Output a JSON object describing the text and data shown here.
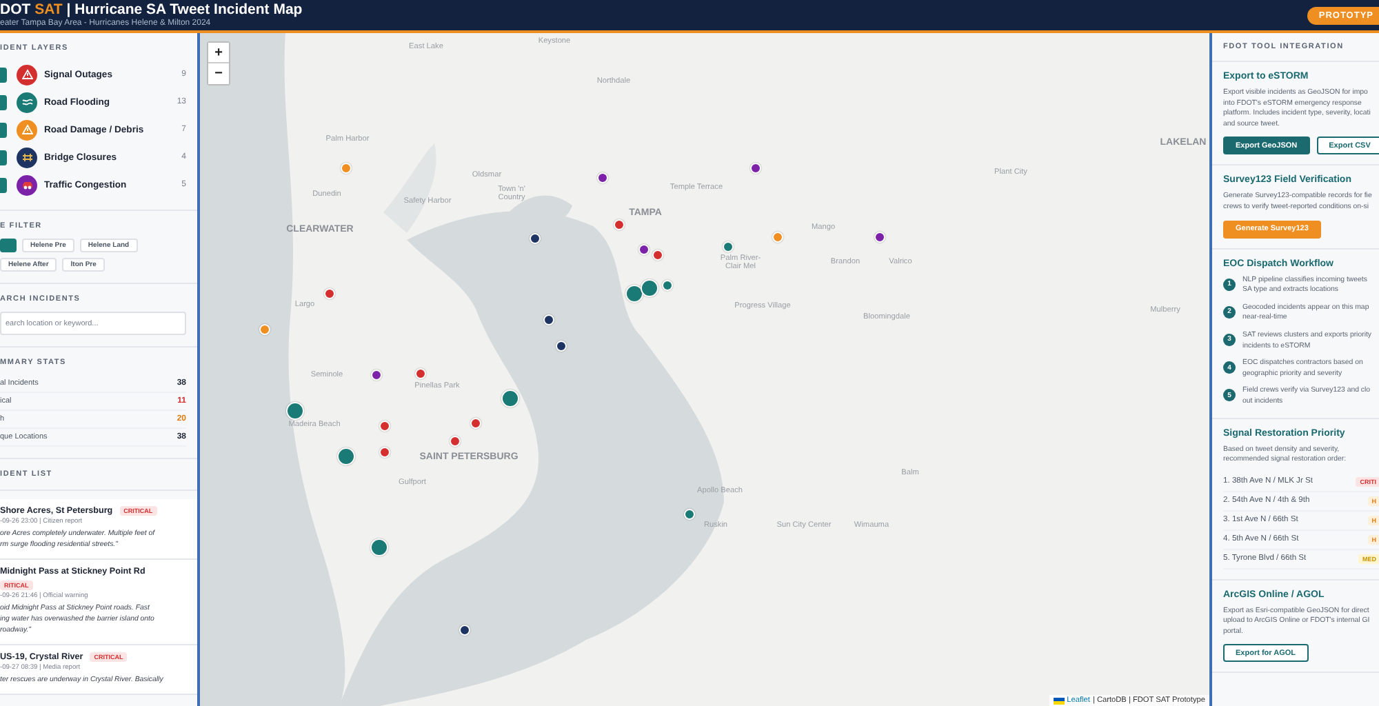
{
  "header": {
    "title_start": "DOT",
    "title_accent": "SAT",
    "title_rest": "| Hurricane SA Tweet Incident Map",
    "subtitle": "eater Tampa Bay Area - Hurricanes Helene & Milton 2024",
    "badge": "PROTOTYP"
  },
  "sidebar": {
    "layers_heading": "IDENT LAYERS",
    "layers": [
      {
        "label": "Signal Outages",
        "count": "9",
        "checked": true,
        "color": "#d32f2f",
        "kind": "signal"
      },
      {
        "label": "Road Flooding",
        "count": "13",
        "checked": true,
        "color": "#1a7a76",
        "kind": "flood"
      },
      {
        "label": "Road Damage / Debris",
        "count": "7",
        "checked": true,
        "color": "#ef8f22",
        "kind": "damage"
      },
      {
        "label": "Bridge Closures",
        "count": "4",
        "checked": true,
        "color": "#1e3563",
        "kind": "bridge"
      },
      {
        "label": "Traffic Congestion",
        "count": "5",
        "checked": true,
        "color": "#7b22a8",
        "kind": "traffic"
      }
    ],
    "filter_heading": "E FILTER",
    "filters": [
      {
        "selected": true
      },
      {
        "label": "Helene Pre",
        "selected": false
      },
      {
        "label": "Helene Land",
        "selected": false
      },
      {
        "label": "Helene After",
        "selected": false
      },
      {
        "label": "lton Pre",
        "selected": false
      }
    ],
    "search_heading": "ARCH INCIDENTS",
    "search": {
      "placeholder": "earch location or keyword..."
    },
    "stats_heading": "MMARY STATS",
    "stats": [
      {
        "label": "al Incidents",
        "value": "38",
        "kind": "plain"
      },
      {
        "label": "ical",
        "value": "11",
        "kind": "critical"
      },
      {
        "label": "h",
        "value": "20",
        "kind": "high"
      },
      {
        "label": "que Locations",
        "value": "38",
        "kind": "plain"
      }
    ],
    "list_heading": "IDENT LIST",
    "incidents": [
      {
        "title": "Shore Acres, St Petersburg",
        "badge": "CRITICAL",
        "meta": "-09-26 23:00 | Citizen report",
        "text": "ore Acres completely underwater. Multiple feet of\nrm surge flooding residential streets.\""
      },
      {
        "title": "Midnight Pass at Stickney Point Rd",
        "badge": "RITICAL",
        "meta": "-09-26 21:46 | Official warning",
        "text": "oid Midnight Pass at Stickney Point roads. Fast\ning water has overwashed the barrier island onto\nroadway.\""
      },
      {
        "title": "US-19, Crystal River",
        "badge": "CRITICAL",
        "meta": "-09-27 08:39 | Media report",
        "text": "ter rescues are underway in Crystal River. Basically"
      }
    ]
  },
  "map": {
    "zoom_in": "+",
    "zoom_out": "−",
    "attribution_link": "Leaflet",
    "attribution": "| CartoDB | FDOT SAT Prototype",
    "place_labels": [
      "Keystone",
      "East Lake",
      "Northdale",
      "Palm Harbor",
      "Oldsmar",
      "Dunedin",
      "Safety Harbor",
      "CLEARWATER",
      "Town 'n'\nCountry",
      "Temple Terrace",
      "Plant City",
      "LAKELAN",
      "Mango",
      "Palm River-\nClair Mel",
      "Brandon",
      "Valrico",
      "Progress Village",
      "Bloomingdale",
      "Mulberry",
      "Largo",
      "Seminole",
      "Pinellas Park",
      "Madeira Beach",
      "SAINT PETERSBURG",
      "Gulfport",
      "Apollo Beach",
      "Ruskin",
      "Sun City Center",
      "Wimauma",
      "Balm",
      "TAMPA"
    ],
    "markers": [
      {
        "kind": "damage",
        "cluster": false
      },
      {
        "kind": "bridge",
        "cluster": false
      },
      {
        "kind": "traffic",
        "cluster": false
      },
      {
        "kind": "signal",
        "cluster": false
      },
      {
        "kind": "traffic",
        "cluster": false
      },
      {
        "kind": "signal",
        "cluster": false
      },
      {
        "kind": "flood",
        "cluster": false
      },
      {
        "kind": "traffic",
        "cluster": false
      },
      {
        "kind": "damage",
        "cluster": false
      },
      {
        "kind": "traffic",
        "cluster": false
      },
      {
        "kind": "flood",
        "cluster": true
      },
      {
        "kind": "flood",
        "cluster": true
      },
      {
        "kind": "flood",
        "cluster": false
      },
      {
        "kind": "bridge",
        "cluster": false
      },
      {
        "kind": "bridge",
        "cluster": false
      },
      {
        "kind": "damage",
        "cluster": false
      },
      {
        "kind": "signal",
        "cluster": false
      },
      {
        "kind": "traffic",
        "cluster": false
      },
      {
        "kind": "signal",
        "cluster": false
      },
      {
        "kind": "flood",
        "cluster": true
      },
      {
        "kind": "flood",
        "cluster": true
      },
      {
        "kind": "signal",
        "cluster": false
      },
      {
        "kind": "signal",
        "cluster": false
      },
      {
        "kind": "signal",
        "cluster": false
      },
      {
        "kind": "signal",
        "cluster": false
      },
      {
        "kind": "flood",
        "cluster": true
      },
      {
        "kind": "flood",
        "cluster": false
      },
      {
        "kind": "flood",
        "cluster": true
      },
      {
        "kind": "bridge",
        "cluster": false
      }
    ]
  },
  "tools": {
    "heading": "FDOT TOOL INTEGRATION",
    "estorm": {
      "title": "Export to eSTORM",
      "text": "Export visible incidents as GeoJSON for impo\ninto FDOT's eSTORM emergency response\nplatform. Includes incident type, severity, locati\nand source tweet.",
      "primary": "Export GeoJSON",
      "secondary": "Export CSV"
    },
    "survey": {
      "title": "Survey123 Field Verification",
      "text": "Generate Survey123-compatible records for fie\ncrews to verify tweet-reported conditions on-si",
      "button": "Generate Survey123"
    },
    "workflow": {
      "title": "EOC Dispatch Workflow",
      "steps": [
        {
          "num": "1",
          "text": "NLP pipeline classifies incoming tweets\nSA type and extracts locations"
        },
        {
          "num": "2",
          "text": "Geocoded incidents appear on this map\nnear-real-time"
        },
        {
          "num": "3",
          "text": "SAT reviews clusters and exports priority\nincidents to eSTORM"
        },
        {
          "num": "4",
          "text": "EOC dispatches contractors based on\ngeographic priority and severity"
        },
        {
          "num": "5",
          "text": "Field crews verify via Survey123 and clo\nout incidents"
        }
      ]
    },
    "signal": {
      "title": "Signal Restoration Priority",
      "text": "Based on tweet density and severity,\nrecommended signal restoration order:",
      "items": [
        {
          "label": "1. 38th Ave N / MLK Jr St",
          "badge": "CRITI",
          "kind": "critical"
        },
        {
          "label": "2. 54th Ave N / 4th & 9th",
          "badge": "H",
          "kind": "high"
        },
        {
          "label": "3. 1st Ave N / 66th St",
          "badge": "H",
          "kind": "high"
        },
        {
          "label": "4. 5th Ave N / 66th St",
          "badge": "H",
          "kind": "high"
        },
        {
          "label": "5. Tyrone Blvd / 66th St",
          "badge": "MED",
          "kind": "medium"
        }
      ]
    },
    "agol": {
      "title": "ArcGIS Online / AGOL",
      "text": "Export as Esri-compatible GeoJSON for direct\nupload to ArcGIS Online or FDOT's internal GI\nportal.",
      "button": "Export for AGOL"
    }
  }
}
